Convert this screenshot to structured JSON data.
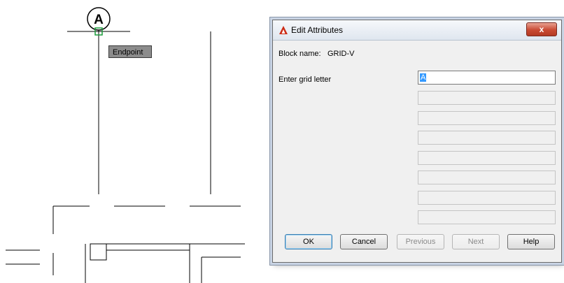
{
  "canvas": {
    "tag_letter": "A",
    "tooltip": "Endpoint"
  },
  "dialog": {
    "title": "Edit Attributes",
    "close_label": "x",
    "block_name_label": "Block name:",
    "block_name_value": "GRID-V",
    "prompt_label": "Enter grid letter",
    "field_value": "A",
    "empty_fields": [
      "",
      "",
      "",
      "",
      "",
      "",
      ""
    ],
    "buttons": {
      "ok": "OK",
      "cancel": "Cancel",
      "previous": "Previous",
      "next": "Next",
      "help": "Help"
    }
  },
  "colors": {
    "brand": "#cc2a14",
    "snap_marker": "#1a9c3a",
    "close_button": "#c94a33"
  }
}
